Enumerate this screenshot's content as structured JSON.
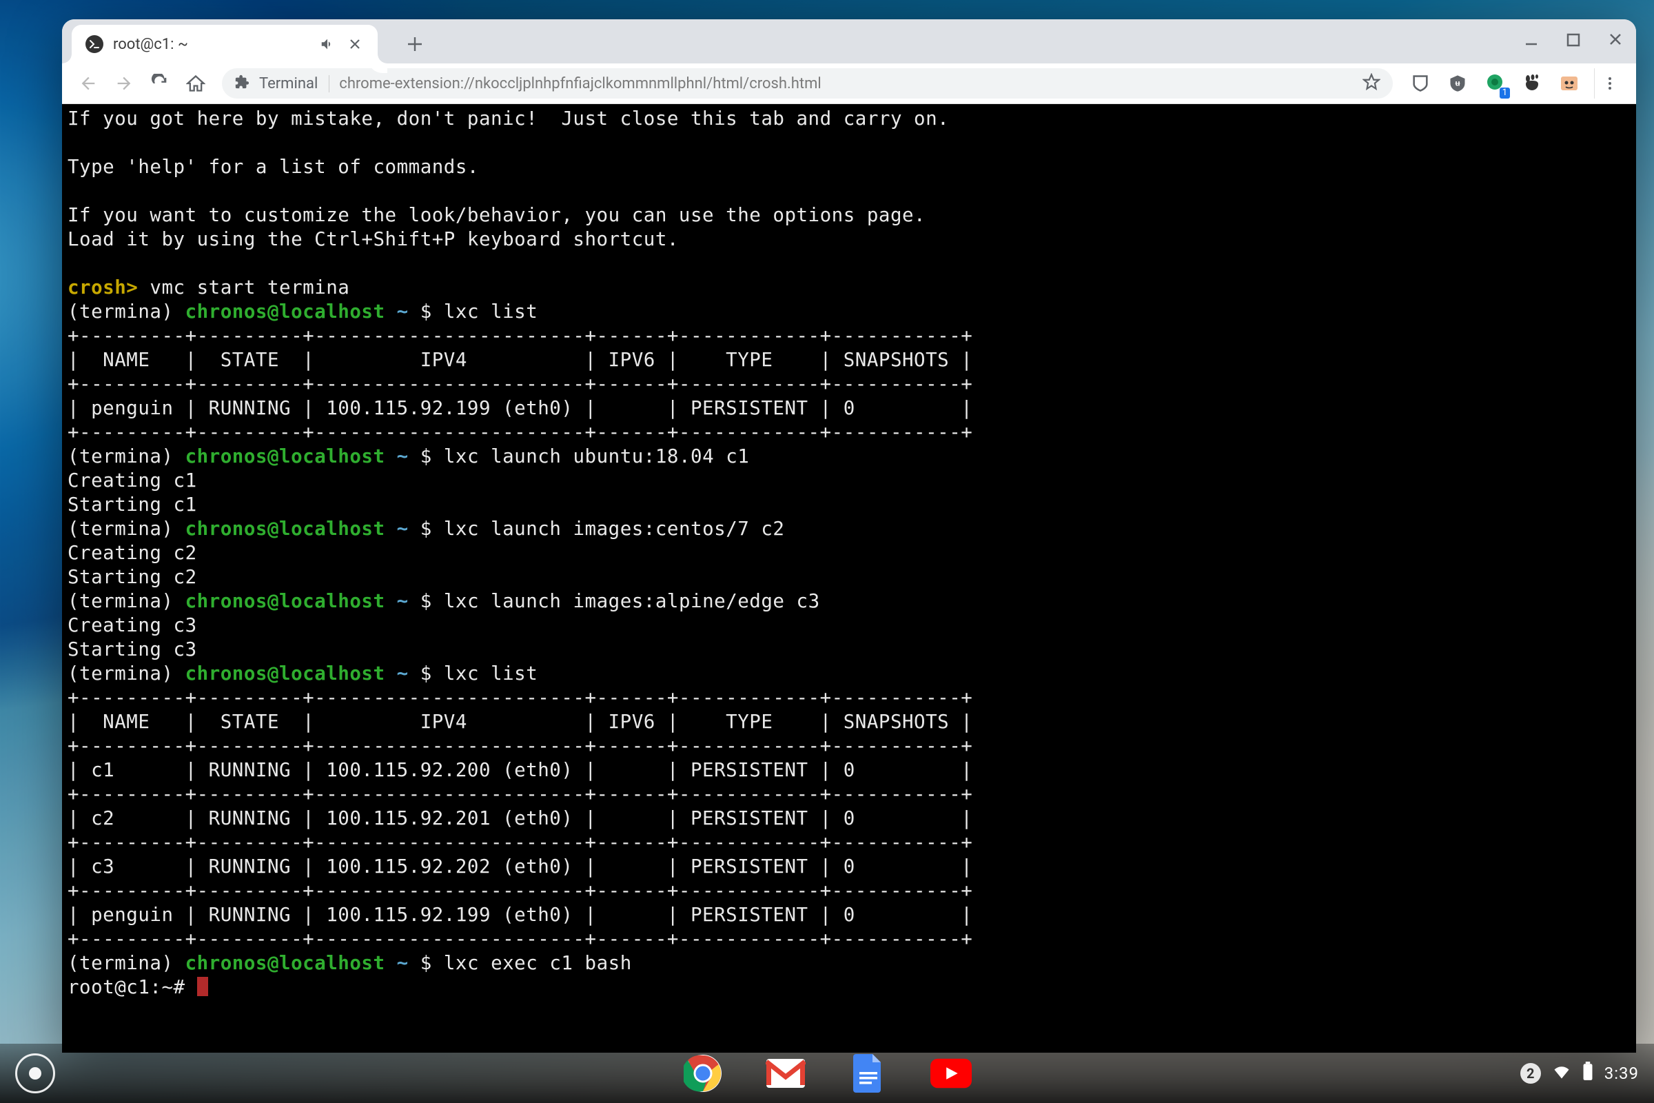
{
  "tab": {
    "title": "root@c1: ~"
  },
  "toolbar": {
    "omni_prefix": "Terminal",
    "url": "chrome-extension://nkoccljplnhpfnfiajclkommnmllphnl/html/crosh.html",
    "ext_badge": "1"
  },
  "term": {
    "intro": [
      "If you got here by mistake, don't panic!  Just close this tab and carry on.",
      "",
      "Type 'help' for a list of commands.",
      "",
      "If you want to customize the look/behavior, you can use the options page.",
      "Load it by using the Ctrl+Shift+P keyboard shortcut.",
      ""
    ],
    "crosh_prompt": "crosh>",
    "crosh_cmd": " vmc start termina",
    "ps1_context": "(termina) ",
    "ps1_user": "chronos@localhost",
    "ps1_path": " ~ ",
    "ps1_dollar": "$ ",
    "cmd_list1": "lxc list",
    "table1": [
      "+---------+---------+-----------------------+------+------------+-----------+",
      "|  NAME   |  STATE  |         IPV4          | IPV6 |    TYPE    | SNAPSHOTS |",
      "+---------+---------+-----------------------+------+------------+-----------+",
      "| penguin | RUNNING | 100.115.92.199 (eth0) |      | PERSISTENT | 0         |",
      "+---------+---------+-----------------------+------+------------+-----------+"
    ],
    "cmd_launch1": "lxc launch ubuntu:18.04 c1",
    "out_launch1": [
      "Creating c1",
      "Starting c1"
    ],
    "cmd_launch2": "lxc launch images:centos/7 c2",
    "out_launch2": [
      "Creating c2",
      "Starting c2"
    ],
    "cmd_launch3": "lxc launch images:alpine/edge c3",
    "out_launch3": [
      "Creating c3",
      "Starting c3"
    ],
    "cmd_list2": "lxc list",
    "table2": [
      "+---------+---------+-----------------------+------+------------+-----------+",
      "|  NAME   |  STATE  |         IPV4          | IPV6 |    TYPE    | SNAPSHOTS |",
      "+---------+---------+-----------------------+------+------------+-----------+",
      "| c1      | RUNNING | 100.115.92.200 (eth0) |      | PERSISTENT | 0         |",
      "+---------+---------+-----------------------+------+------------+-----------+",
      "| c2      | RUNNING | 100.115.92.201 (eth0) |      | PERSISTENT | 0         |",
      "+---------+---------+-----------------------+------+------------+-----------+",
      "| c3      | RUNNING | 100.115.92.202 (eth0) |      | PERSISTENT | 0         |",
      "+---------+---------+-----------------------+------+------------+-----------+",
      "| penguin | RUNNING | 100.115.92.199 (eth0) |      | PERSISTENT | 0         |",
      "+---------+---------+-----------------------+------+------------+-----------+"
    ],
    "cmd_exec": "lxc exec c1 bash",
    "root_prompt": "root@c1:~# "
  },
  "shelf": {
    "notif_count": "2",
    "clock": "3:39"
  }
}
